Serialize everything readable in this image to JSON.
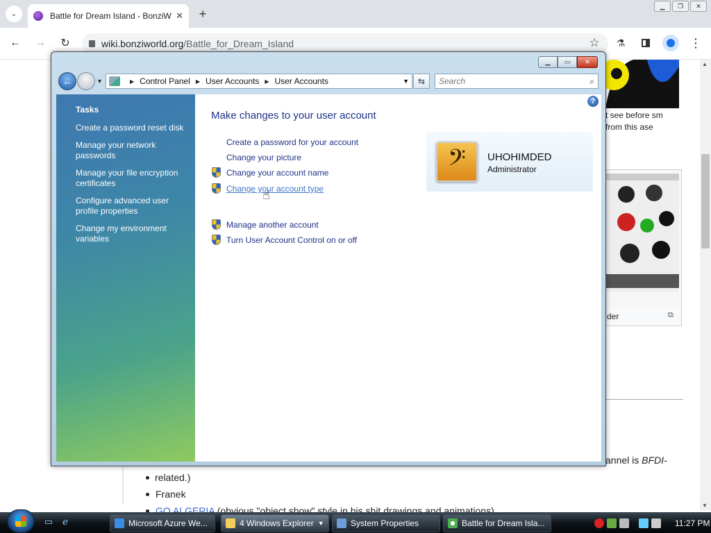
{
  "browser": {
    "tab_title": "Battle for Dream Island - BonziWorld",
    "tab_close": "✕",
    "new_tab": "+",
    "url_host": "wiki.bonziworld.org",
    "url_path": "/Battle_for_Dream_Island",
    "back": "←",
    "forward": "→",
    "reload": "↻",
    "star": "☆",
    "menu": "⋮"
  },
  "wiki": {
    "caption1": "t see before sm from this ase",
    "caption2": "der",
    "line1_text": "annel is ",
    "line1_em": "BFDI-",
    "list": [
      {
        "text": "related.)",
        "continuation": true
      },
      {
        "text": "Franek"
      },
      {
        "link": "GO ALGERIA",
        "text": " (obvious \"object show\" style in his shit drawings and animations)"
      }
    ]
  },
  "explorer": {
    "breadcrumb": [
      "Control Panel",
      "User Accounts",
      "User Accounts"
    ],
    "search_placeholder": "Search",
    "tasks_heading": "Tasks",
    "tasks": [
      "Create a password reset disk",
      "Manage your network passwords",
      "Manage your file encryption certificates",
      "Configure advanced user profile properties",
      "Change my environment variables"
    ],
    "main_title": "Make changes to your user account",
    "links": {
      "create_password": "Create a password for your account",
      "change_picture": "Change your picture",
      "change_name": "Change your account name",
      "change_type": "Change your account type",
      "manage_another": "Manage another account",
      "uac": "Turn User Account Control on or off"
    },
    "user_name": "UHOHIMDED",
    "user_role": "Administrator",
    "help": "?"
  },
  "taskbar": {
    "buttons": [
      {
        "label": "Microsoft Azure We..."
      },
      {
        "label": "4 Windows Explorer"
      },
      {
        "label": "System Properties"
      },
      {
        "label": "Battle for Dream Isla..."
      }
    ],
    "clock": "11:27 PM"
  },
  "colors": {
    "vista_link": "#1e3287",
    "taskbar": "#0d1216"
  }
}
